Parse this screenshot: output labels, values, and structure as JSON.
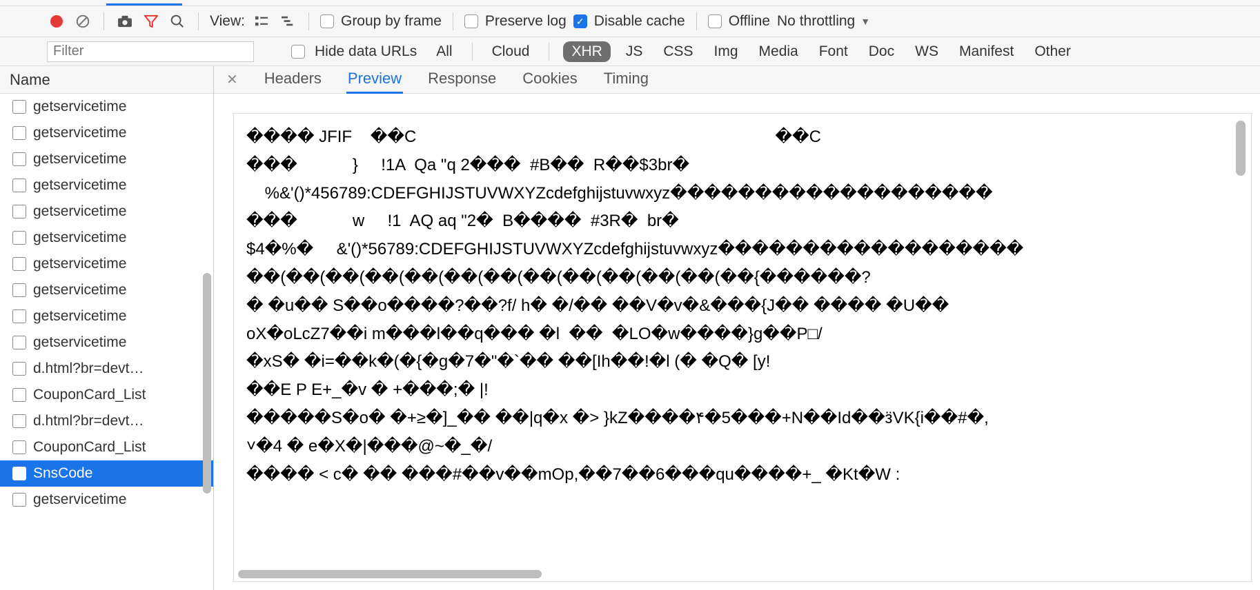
{
  "toolbar": {
    "view_label": "View:",
    "group_by_frame": "Group by frame",
    "preserve_log": "Preserve log",
    "disable_cache": "Disable cache",
    "offline": "Offline",
    "throttling": "No throttling"
  },
  "filter": {
    "placeholder": "Filter",
    "hide_data_urls": "Hide data URLs",
    "categories": [
      "All",
      "Cloud",
      "XHR",
      "JS",
      "CSS",
      "Img",
      "Media",
      "Font",
      "Doc",
      "WS",
      "Manifest",
      "Other"
    ],
    "active_category": "XHR"
  },
  "sidebar": {
    "header": "Name",
    "requests": [
      {
        "label": "getservicetime"
      },
      {
        "label": "getservicetime"
      },
      {
        "label": "getservicetime"
      },
      {
        "label": "getservicetime"
      },
      {
        "label": "getservicetime"
      },
      {
        "label": "getservicetime"
      },
      {
        "label": "getservicetime"
      },
      {
        "label": "getservicetime"
      },
      {
        "label": "getservicetime"
      },
      {
        "label": "getservicetime"
      },
      {
        "label": "d.html?br=devt…"
      },
      {
        "label": "CouponCard_List"
      },
      {
        "label": "d.html?br=devt…"
      },
      {
        "label": "CouponCard_List"
      },
      {
        "label": "SnsCode"
      },
      {
        "label": "getservicetime"
      }
    ],
    "selected_index": 14
  },
  "detail": {
    "tabs": [
      "Headers",
      "Preview",
      "Response",
      "Cookies",
      "Timing"
    ],
    "active_tab": "Preview",
    "preview_text": "���� JFIF    ��C                                                                              ��C\n���            }     !1A  Qa \"q 2���  #B��  R��$3br�\n    %&'()*456789:CDEFGHIJSTUVWXYZcdefghijstuvwxyz�������������������\n���            w     !1  AQ aq \"2�  B����  #3R�  br�\n$4�%�     &'()*56789:CDEFGHIJSTUVWXYZcdefghijstuvwxyz������������������\n��(��(��(��(��(��(��(��(��(��(��(��(��{������?\n� �u�� S��o����?��?f/ h� �/�� ��V�v�&���{J�� ���� �U��\noX�oLcZ7��i m���l��q��� �l  ��  �LO�w����}g��P□/\n�xS� �i=��k�(�{�g�7�\"�`�� ��[Ih��!�l (� �Q� [y!\n��E P E+_�v � +���;� |!\n�����S�o� �+≥�]_�� ��|q�x �> }kZ����۴�5���+N��Id��ӟVK{i��#�,\n˅�4 � e�X�|���@~�_�/\n���� < c� �� ���#��v��mOp,��7��6���qu����+_ �Kt�W :"
  }
}
